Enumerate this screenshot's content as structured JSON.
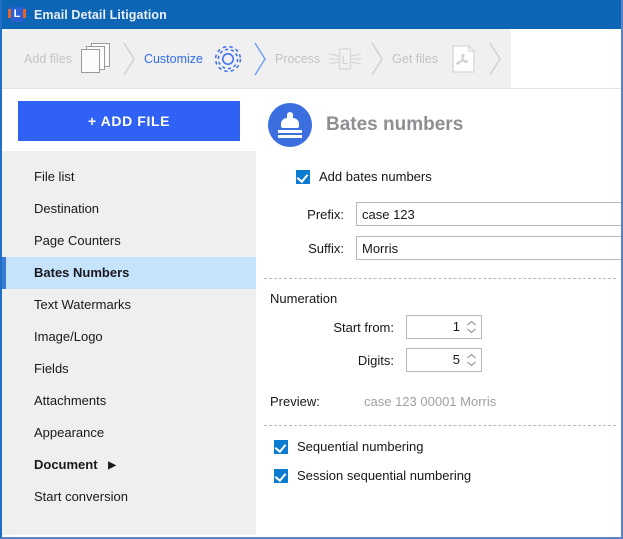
{
  "window": {
    "title": "Email Detail Litigation",
    "app_icon": "litigation-app-icon",
    "app_icon_letter": "L",
    "titlebar_color": "#0d65b5"
  },
  "wizard": {
    "steps": [
      {
        "label": "Add files",
        "icon": "stacked-pages-icon",
        "active": false
      },
      {
        "label": "Customize",
        "icon": "gear-icon",
        "active": true
      },
      {
        "label": "Process",
        "icon": "winged-l-icon",
        "active": false
      },
      {
        "label": "Get files",
        "icon": "pdf-file-icon",
        "active": false
      }
    ],
    "active_color": "#2f6df0",
    "inactive_color": "#c3c3c3"
  },
  "sidebar": {
    "add_file_button": "+ ADD FILE",
    "accent_color": "#2f62f4",
    "selected_bg": "#c6e3fc",
    "items": [
      {
        "label": "File list",
        "state": "normal"
      },
      {
        "label": "Destination",
        "state": "normal"
      },
      {
        "label": "Page Counters",
        "state": "normal"
      },
      {
        "label": "Bates Numbers",
        "state": "selected"
      },
      {
        "label": "Text Watermarks",
        "state": "normal"
      },
      {
        "label": "Image/Logo",
        "state": "normal"
      },
      {
        "label": "Fields",
        "state": "normal"
      },
      {
        "label": "Attachments",
        "state": "normal"
      },
      {
        "label": "Appearance",
        "state": "normal"
      },
      {
        "label": "Document",
        "state": "bold",
        "arrow": "▶"
      },
      {
        "label": "Start conversion",
        "state": "normal"
      }
    ]
  },
  "panel": {
    "icon": "stamp-icon",
    "title": "Bates numbers",
    "enable_checkbox": {
      "label": "Add bates numbers",
      "checked": true
    },
    "fields": [
      {
        "label": "Prefix:",
        "value": "case 123",
        "placeholder": ""
      },
      {
        "label": "Suffix:",
        "value": "Morris",
        "placeholder": ""
      }
    ],
    "numeration": {
      "section_label": "Numeration",
      "start_from": {
        "label": "Start from:",
        "value": "1"
      },
      "digits": {
        "label": "Digits:",
        "value": "5"
      }
    },
    "preview": {
      "label": "Preview:",
      "value": "case 123 00001 Morris"
    },
    "options": [
      {
        "label": "Sequential numbering",
        "checked": true
      },
      {
        "label": "Session sequential numbering",
        "checked": true
      }
    ]
  }
}
